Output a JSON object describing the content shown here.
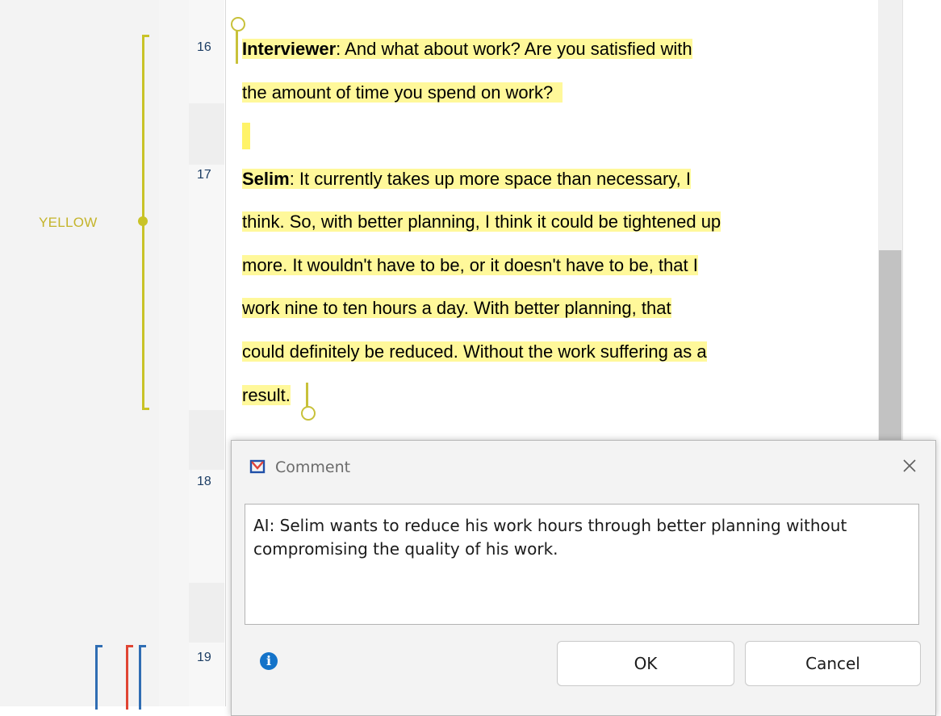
{
  "code_margin": {
    "code_label": "YELLOW",
    "colors": {
      "yellow": "#c9c327",
      "blue": "#2f6db3",
      "red": "#e04433"
    }
  },
  "line_numbers": [
    "16",
    "17",
    "18",
    "19"
  ],
  "document": {
    "para16": {
      "speaker": "Interviewer",
      "line1_rest": ": And what about work? Are you satisfied with",
      "line2": "the amount of time you spend on work?"
    },
    "para17": {
      "speaker": "Selim",
      "line1_rest": ": It currently takes up more space than necessary, I",
      "line2": "think. So, with better planning, I think it could be tightened up",
      "line3": "more. It wouldn't have to be, or it doesn't have to be, that I",
      "line4": "work nine to ten hours a day. With better planning, that",
      "line5": "could definitely be reduced. Without the work suffering as a",
      "line6": "result."
    },
    "highlight_color": "#fff89a"
  },
  "comment_dialog": {
    "title": "Comment",
    "comment_text": "AI: Selim wants to reduce his work hours through better planning without compromising the quality of his work.",
    "ok_label": "OK",
    "cancel_label": "Cancel",
    "close_icon": "close-icon",
    "info_icon": "info-icon",
    "logo_icon": "maxqda-logo-icon"
  }
}
